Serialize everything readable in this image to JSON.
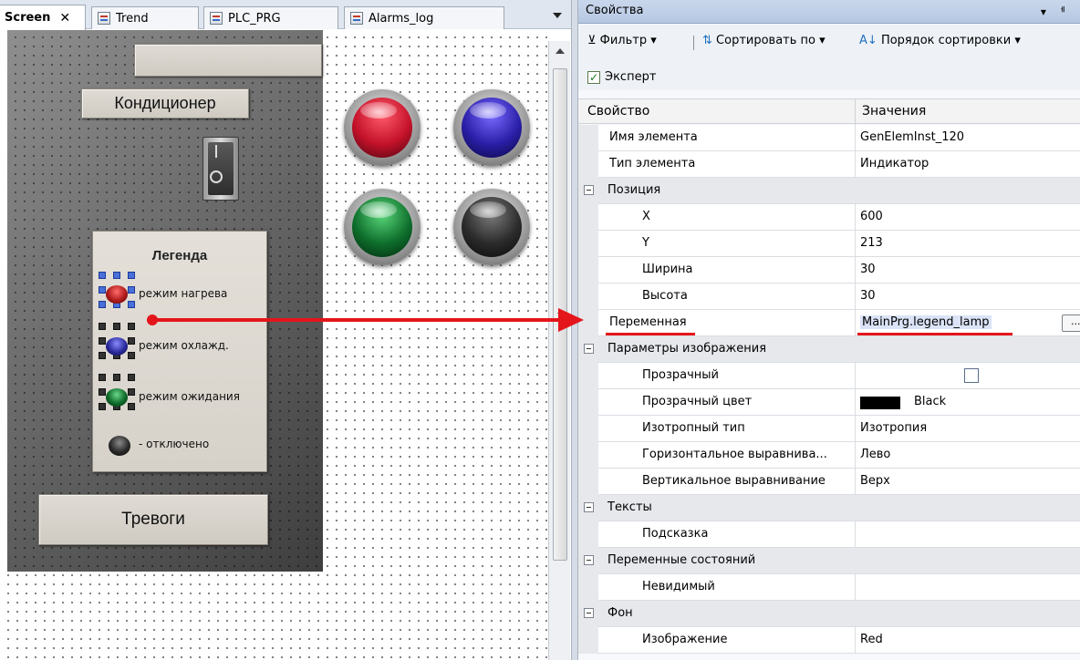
{
  "tabs": [
    {
      "label": "Screen",
      "active": true
    },
    {
      "label": "Trend"
    },
    {
      "label": "PLC_PRG"
    },
    {
      "label": "Alarms_log"
    }
  ],
  "canvas": {
    "button_conditioner": "Кондиционер",
    "button_alarms": "Тревоги",
    "legend": {
      "title": "Легенда",
      "items": [
        {
          "label": "режим нагрева",
          "color": "#b01b1b"
        },
        {
          "label": "режим охлажд.",
          "color": "#2a2a9c"
        },
        {
          "label": "режим ожидания",
          "color": "#0f6a2a"
        },
        {
          "label": "- отключено",
          "color": "#2a2a2a"
        }
      ]
    },
    "lamps": [
      {
        "name": "red-lamp",
        "color": "#c4122a"
      },
      {
        "name": "blue-lamp",
        "color": "#2a1fa8"
      },
      {
        "name": "green-lamp",
        "color": "#0e6f2c"
      },
      {
        "name": "black-lamp",
        "color": "#2b2b2b"
      }
    ]
  },
  "properties": {
    "title": "Свойства",
    "toolbar": {
      "filter": "Фильтр",
      "sort_by": "Сортировать по",
      "sort_order": "Порядок сортировки"
    },
    "expert_label": "Эксперт",
    "expert_checked": true,
    "header": {
      "property": "Свойство",
      "values": "Значения"
    },
    "rows": [
      {
        "name": "Имя элемента",
        "value": "GenElemInst_120",
        "indent": 1
      },
      {
        "name": "Тип элемента",
        "value": "Индикатор",
        "indent": 1
      },
      {
        "name": "Позиция",
        "value": "",
        "group": true
      },
      {
        "name": "X",
        "value": "600",
        "indent": 2
      },
      {
        "name": "Y",
        "value": "213",
        "indent": 2
      },
      {
        "name": "Ширина",
        "value": "30",
        "indent": 2
      },
      {
        "name": "Высота",
        "value": "30",
        "indent": 2
      },
      {
        "name": "Переменная",
        "value": "MainPrg.legend_lamp",
        "indent": 1,
        "highlight": true
      },
      {
        "name": "Параметры изображения",
        "value": "",
        "group": true
      },
      {
        "name": "Прозрачный",
        "value": "",
        "indent": 2,
        "checkbox": true
      },
      {
        "name": "Прозрачный цвет",
        "value": "Black",
        "indent": 2,
        "swatch": "#000000"
      },
      {
        "name": "Изотропный тип",
        "value": "Изотропия",
        "indent": 2
      },
      {
        "name": "Горизонтальное выравнива...",
        "value": "Лево",
        "indent": 2
      },
      {
        "name": "Вертикальное выравнивание",
        "value": "Верх",
        "indent": 2
      },
      {
        "name": "Тексты",
        "value": "",
        "group": true
      },
      {
        "name": "Подсказка",
        "value": "",
        "indent": 2
      },
      {
        "name": "Переменные состояний",
        "value": "",
        "group": true
      },
      {
        "name": "Невидимый",
        "value": "",
        "indent": 2
      },
      {
        "name": "Фон",
        "value": "",
        "group": true
      },
      {
        "name": "Изображение",
        "value": "Red",
        "indent": 2
      }
    ],
    "more_button": "..."
  },
  "colors": {
    "annotation": "#e4151b",
    "selection": "#4a6fd8"
  }
}
